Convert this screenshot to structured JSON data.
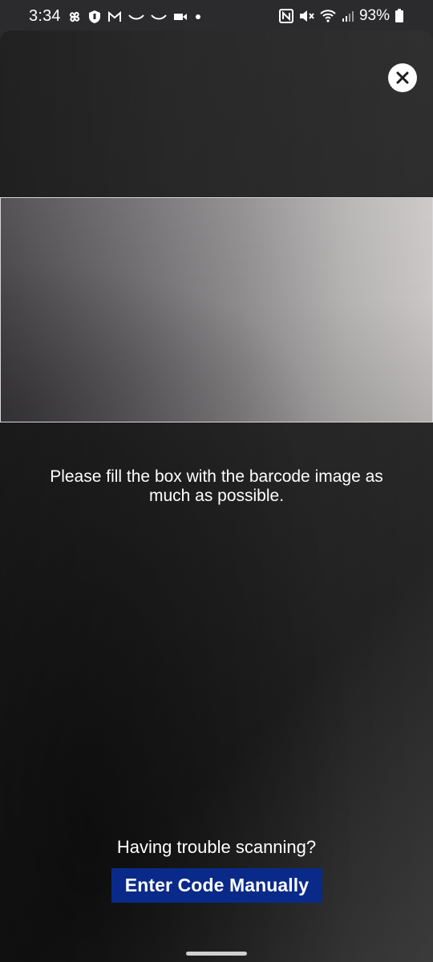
{
  "status_bar": {
    "time": "3:34",
    "battery_percent": "93%",
    "left_icons": [
      "pinwheel-icon",
      "shield-icon",
      "gmail-icon",
      "wave-icon",
      "wave-icon",
      "video-icon",
      "dot-icon"
    ],
    "right_icons": [
      "nfc-icon",
      "mute-icon",
      "wifi-icon",
      "signal-icon",
      "battery-icon"
    ]
  },
  "scanner": {
    "instruction": "Please fill the box with the barcode image as much as possible.",
    "trouble_text": "Having trouble scanning?",
    "enter_code_label": "Enter Code Manually",
    "close_icon": "close-icon"
  },
  "colors": {
    "button_bg": "#0a2a8a",
    "text": "#ffffff",
    "scan_border": "#d8d8d8"
  }
}
